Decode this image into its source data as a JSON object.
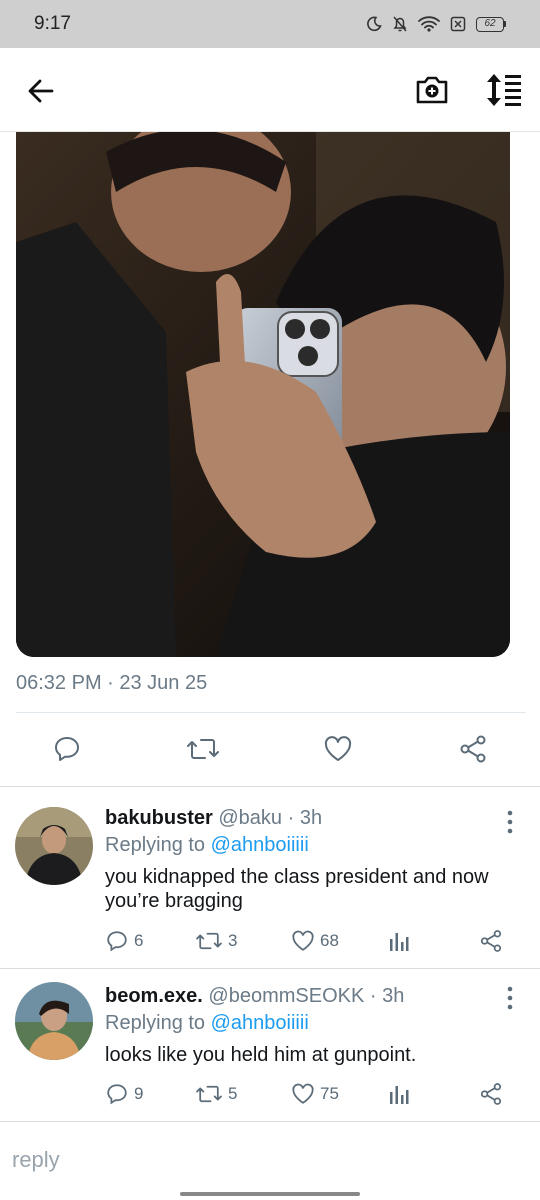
{
  "status_bar": {
    "time": "9:17",
    "battery": "62"
  },
  "tweet": {
    "timestamp": "06:32 PM · 23 Jun 25"
  },
  "replies": [
    {
      "author": "bakubuster",
      "handle": "@baku",
      "time": " · 3h",
      "replying_prefix": "Replying to ",
      "replying_to": "@ahnboiiiii",
      "text": "you kidnapped the class president and now you’re bragging",
      "comments": "6",
      "retweets": "3",
      "likes": "68"
    },
    {
      "author": "beom.exe.",
      "handle": "@beommSEOKK",
      "time": " · 3h",
      "replying_prefix": "Replying to ",
      "replying_to": "@ahnboiiiii",
      "text": "looks like you held him at gunpoint.",
      "comments": "9",
      "retweets": "5",
      "likes": "75"
    }
  ],
  "composer": {
    "placeholder": "reply"
  },
  "colors": {
    "accent": "#1d9bf0",
    "muted": "#6b7a87",
    "status_bar": "#cfcfcf"
  }
}
